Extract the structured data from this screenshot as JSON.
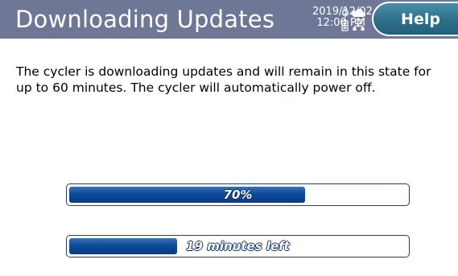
{
  "header": {
    "title": "Downloading Updates",
    "date": "2019/12/02",
    "time": "12:00 PM",
    "help_label": "Help",
    "status_icons": [
      "power-plug-icon",
      "cloud-icon",
      "battery-icon",
      "network-icon"
    ]
  },
  "message": "The cycler is downloading updates and will remain in this state for up to 60 minutes. The cycler will automatically power off.",
  "progress": {
    "percent_label": "70%",
    "percent_value": 0.7,
    "time_label": "19 minutes left",
    "time_fill_fraction": 0.32
  },
  "colors": {
    "header_bg": "#6f7797",
    "help_button": "#2d6f89",
    "bar_fill": "#0e4a96",
    "bar_border": "#2b3b7a"
  }
}
